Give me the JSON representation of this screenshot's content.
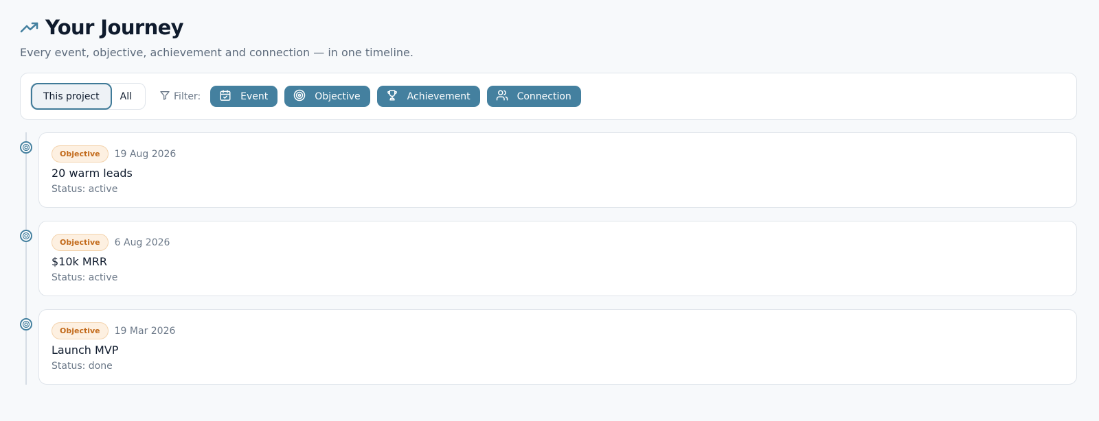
{
  "header": {
    "title": "Your Journey",
    "subtitle": "Every event, objective, achievement and connection — in one timeline.",
    "icon": "trending-up-icon"
  },
  "scope": {
    "options": [
      "This project",
      "All"
    ],
    "selected": "This project"
  },
  "filter": {
    "label": "Filter:",
    "chips": [
      {
        "label": "Event",
        "icon": "calendar-check-icon"
      },
      {
        "label": "Objective",
        "icon": "target-icon"
      },
      {
        "label": "Achievement",
        "icon": "trophy-icon"
      },
      {
        "label": "Connection",
        "icon": "users-icon"
      }
    ]
  },
  "entries": [
    {
      "type": "Objective",
      "date": "19 Aug 2026",
      "title": "20 warm leads",
      "status": "Status: active"
    },
    {
      "type": "Objective",
      "date": "6 Aug 2026",
      "title": "$10k MRR",
      "status": "Status: active"
    },
    {
      "type": "Objective",
      "date": "19 Mar 2026",
      "title": "Launch MVP",
      "status": "Status: done"
    }
  ],
  "colors": {
    "accent": "#44809f",
    "badge_bg": "#fdf0e1",
    "badge_text": "#c26a1b"
  }
}
